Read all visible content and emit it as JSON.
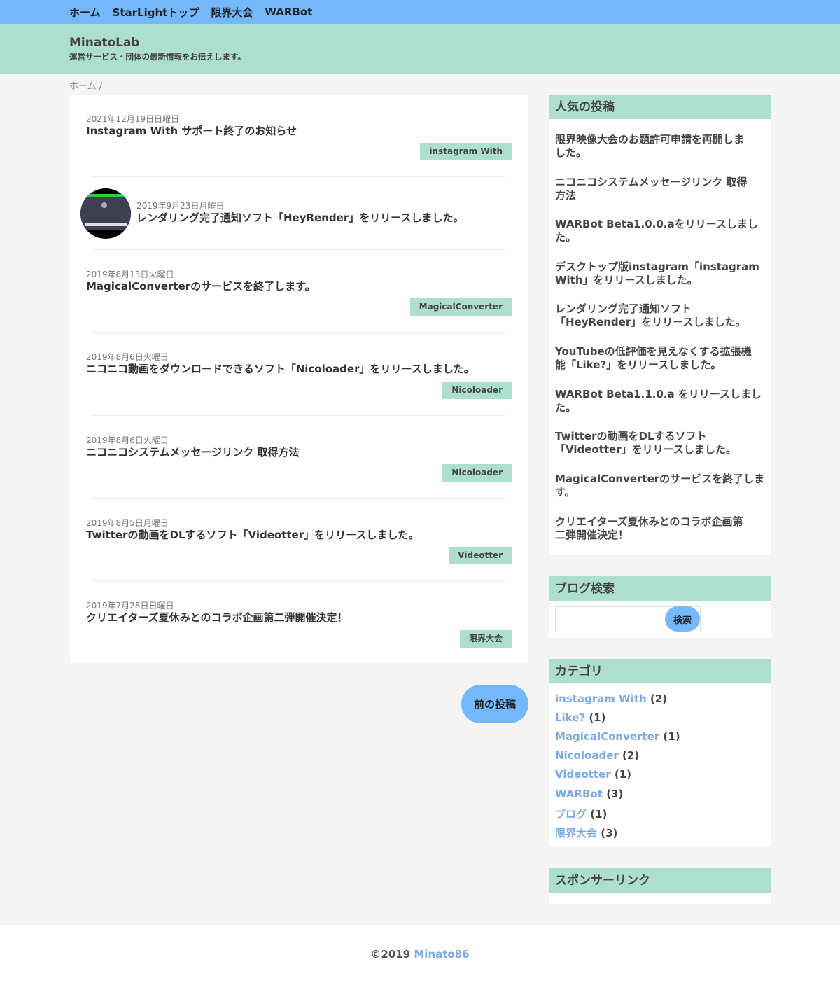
{
  "nav": [
    "ホーム",
    "StarLightトップ",
    "限界大会",
    "WARBot"
  ],
  "site": {
    "title": "MinatoLab",
    "description": "運営サービス・団体の最新情報をお伝えします。"
  },
  "breadcrumb": "ホーム /",
  "posts": [
    {
      "date": "2021年12月19日日曜日",
      "title": "Instagram With サポート終了のお知らせ",
      "tag": "instagram With"
    },
    {
      "date": "2019年9月23日月曜日",
      "title": "レンダリング完了通知ソフト「HeyRender」をリリースしました。",
      "tag": ""
    },
    {
      "date": "2019年8月13日火曜日",
      "title": "MagicalConverterのサービスを終了します。",
      "tag": "MagicalConverter"
    },
    {
      "date": "2019年8月6日火曜日",
      "title": "ニコニコ動画をダウンロードできるソフト「Nicoloader」をリリースしました。",
      "tag": "Nicoloader"
    },
    {
      "date": "2019年8月6日火曜日",
      "title": "ニコニコシステムメッセージリンク 取得方法",
      "tag": "Nicoloader"
    },
    {
      "date": "2019年8月5日月曜日",
      "title": "Twitterの動画をDLするソフト「Videotter」をリリースしました。",
      "tag": "Videotter"
    },
    {
      "date": "2019年7月28日日曜日",
      "title": "クリエイターズ夏休みとのコラボ企画第二弾開催決定！",
      "tag": "限界大会"
    }
  ],
  "prev_button": "前の投稿",
  "popular": {
    "heading": "人気の投稿",
    "items": [
      [
        "限界映像大会のお題許可申請を再開しま",
        "した。"
      ],
      [
        "ニコニコシステムメッセージリンク 取得",
        "方法"
      ],
      [
        "WARBot Beta1.0.0.aをリリースしまし",
        "た。"
      ],
      [
        "デスクトップ版instagram「instagram",
        "With」をリリースしました。"
      ],
      [
        "レンダリング完了通知ソフト",
        "「HeyRender」をリリースしました。"
      ],
      [
        "YouTubeの低評価を見えなくする拡張機",
        "能「Like?」をリリースしました。"
      ],
      [
        "WARBot Beta1.1.0.a をリリースしまし",
        "た。"
      ],
      [
        "Twitterの動画をDLするソフト",
        "「Videotter」をリリースしました。"
      ],
      [
        "MagicalConverterのサービスを終了しま",
        "す。"
      ],
      [
        "クリエイターズ夏休みとのコラボ企画第",
        "二弾開催決定！"
      ]
    ]
  },
  "search": {
    "heading": "ブログ検索",
    "button": "検索",
    "placeholder": ""
  },
  "categories": {
    "heading": "カテゴリ",
    "items": [
      {
        "name": "instagram With",
        "count": "(2)"
      },
      {
        "name": "Like?",
        "count": "(1)"
      },
      {
        "name": "MagicalConverter",
        "count": "(1)"
      },
      {
        "name": "Nicoloader",
        "count": "(2)"
      },
      {
        "name": "Videotter",
        "count": "(1)"
      },
      {
        "name": "WARBot",
        "count": "(3)"
      },
      {
        "name": "ブログ",
        "count": "(1)"
      },
      {
        "name": "限界大会",
        "count": "(3)"
      }
    ]
  },
  "sponsor": {
    "heading": "スポンサーリンク"
  },
  "footer": {
    "copyright": "©2019",
    "author": "Minato86"
  }
}
